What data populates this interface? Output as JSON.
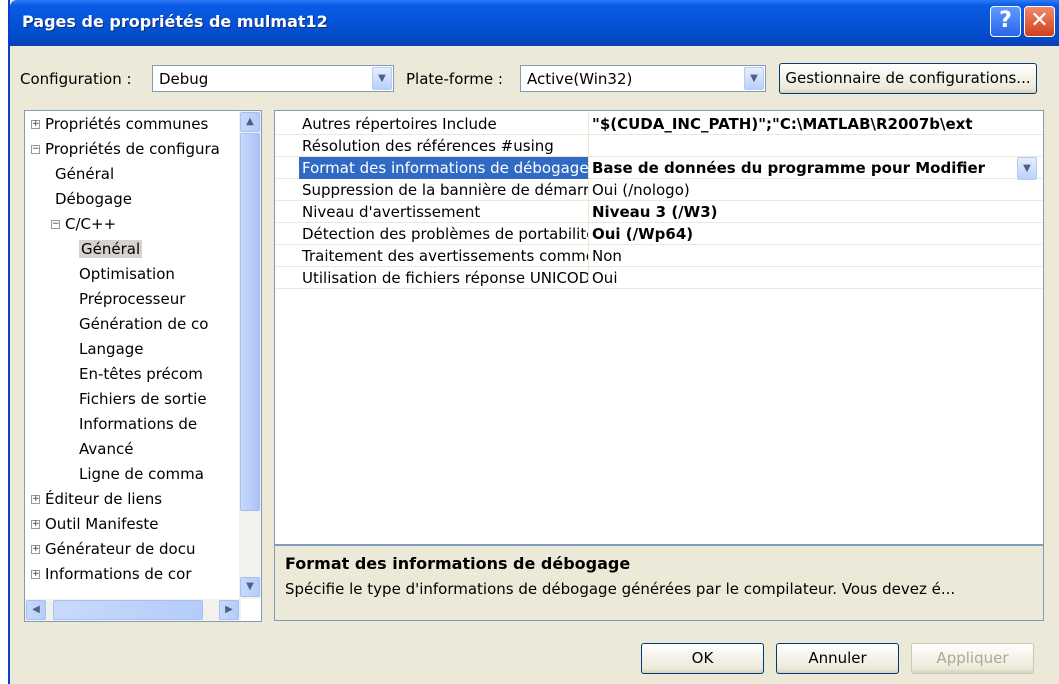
{
  "window": {
    "title": "Pages de propriétés de mulmat12",
    "help_glyph": "?",
    "close_glyph": "✕"
  },
  "top": {
    "config_label": "Configuration :",
    "config_value": "Debug",
    "platform_label": "Plate-forme :",
    "platform_value": "Active(Win32)",
    "manager_button": "Gestionnaire de configurations..."
  },
  "tree": {
    "items": [
      {
        "label": "Propriétés communes",
        "expander": "+"
      },
      {
        "label": "Propriétés de configura",
        "expander": "−"
      },
      {
        "label": "Général"
      },
      {
        "label": "Débogage"
      },
      {
        "label": "C/C++",
        "expander": "−"
      },
      {
        "label": "Général",
        "selected": true
      },
      {
        "label": "Optimisation"
      },
      {
        "label": "Préprocesseur"
      },
      {
        "label": "Génération de co"
      },
      {
        "label": "Langage"
      },
      {
        "label": "En-têtes précom"
      },
      {
        "label": "Fichiers de sortie"
      },
      {
        "label": "Informations de"
      },
      {
        "label": "Avancé"
      },
      {
        "label": "Ligne de comma"
      },
      {
        "label": "Éditeur de liens",
        "expander": "+"
      },
      {
        "label": "Outil Manifeste",
        "expander": "+"
      },
      {
        "label": "Générateur de docu",
        "expander": "+"
      },
      {
        "label": "Informations de cor",
        "expander": "+"
      }
    ]
  },
  "properties": [
    {
      "name": "Autres répertoires Include",
      "value": "\"$(CUDA_INC_PATH)\";\"C:\\MATLAB\\R2007b\\ext",
      "bold": true
    },
    {
      "name": "Résolution des références #using",
      "value": ""
    },
    {
      "name": "Format des informations de débogage",
      "value": "Base de données du programme pour Modifier",
      "bold": true,
      "selected": true
    },
    {
      "name": "Suppression de la bannière de démarrage",
      "value": "Oui (/nologo)"
    },
    {
      "name": "Niveau d'avertissement",
      "value": "Niveau 3 (/W3)",
      "bold": true
    },
    {
      "name": "Détection des problèmes de portabilité",
      "value": "Oui (/Wp64)",
      "bold": true
    },
    {
      "name": "Traitement des avertissements comme des erreurs",
      "value": "Non"
    },
    {
      "name": "Utilisation de fichiers réponse UNICODE",
      "value": "Oui"
    }
  ],
  "description": {
    "title": "Format des informations de débogage",
    "text": "Spécifie le type d'informations de débogage générées par le compilateur. Vous devez é..."
  },
  "buttons": {
    "ok": "OK",
    "cancel": "Annuler",
    "apply": "Appliquer"
  },
  "colors": {
    "title_blue": "#0453d6",
    "selection": "#316ac5",
    "face": "#ece9d8"
  }
}
